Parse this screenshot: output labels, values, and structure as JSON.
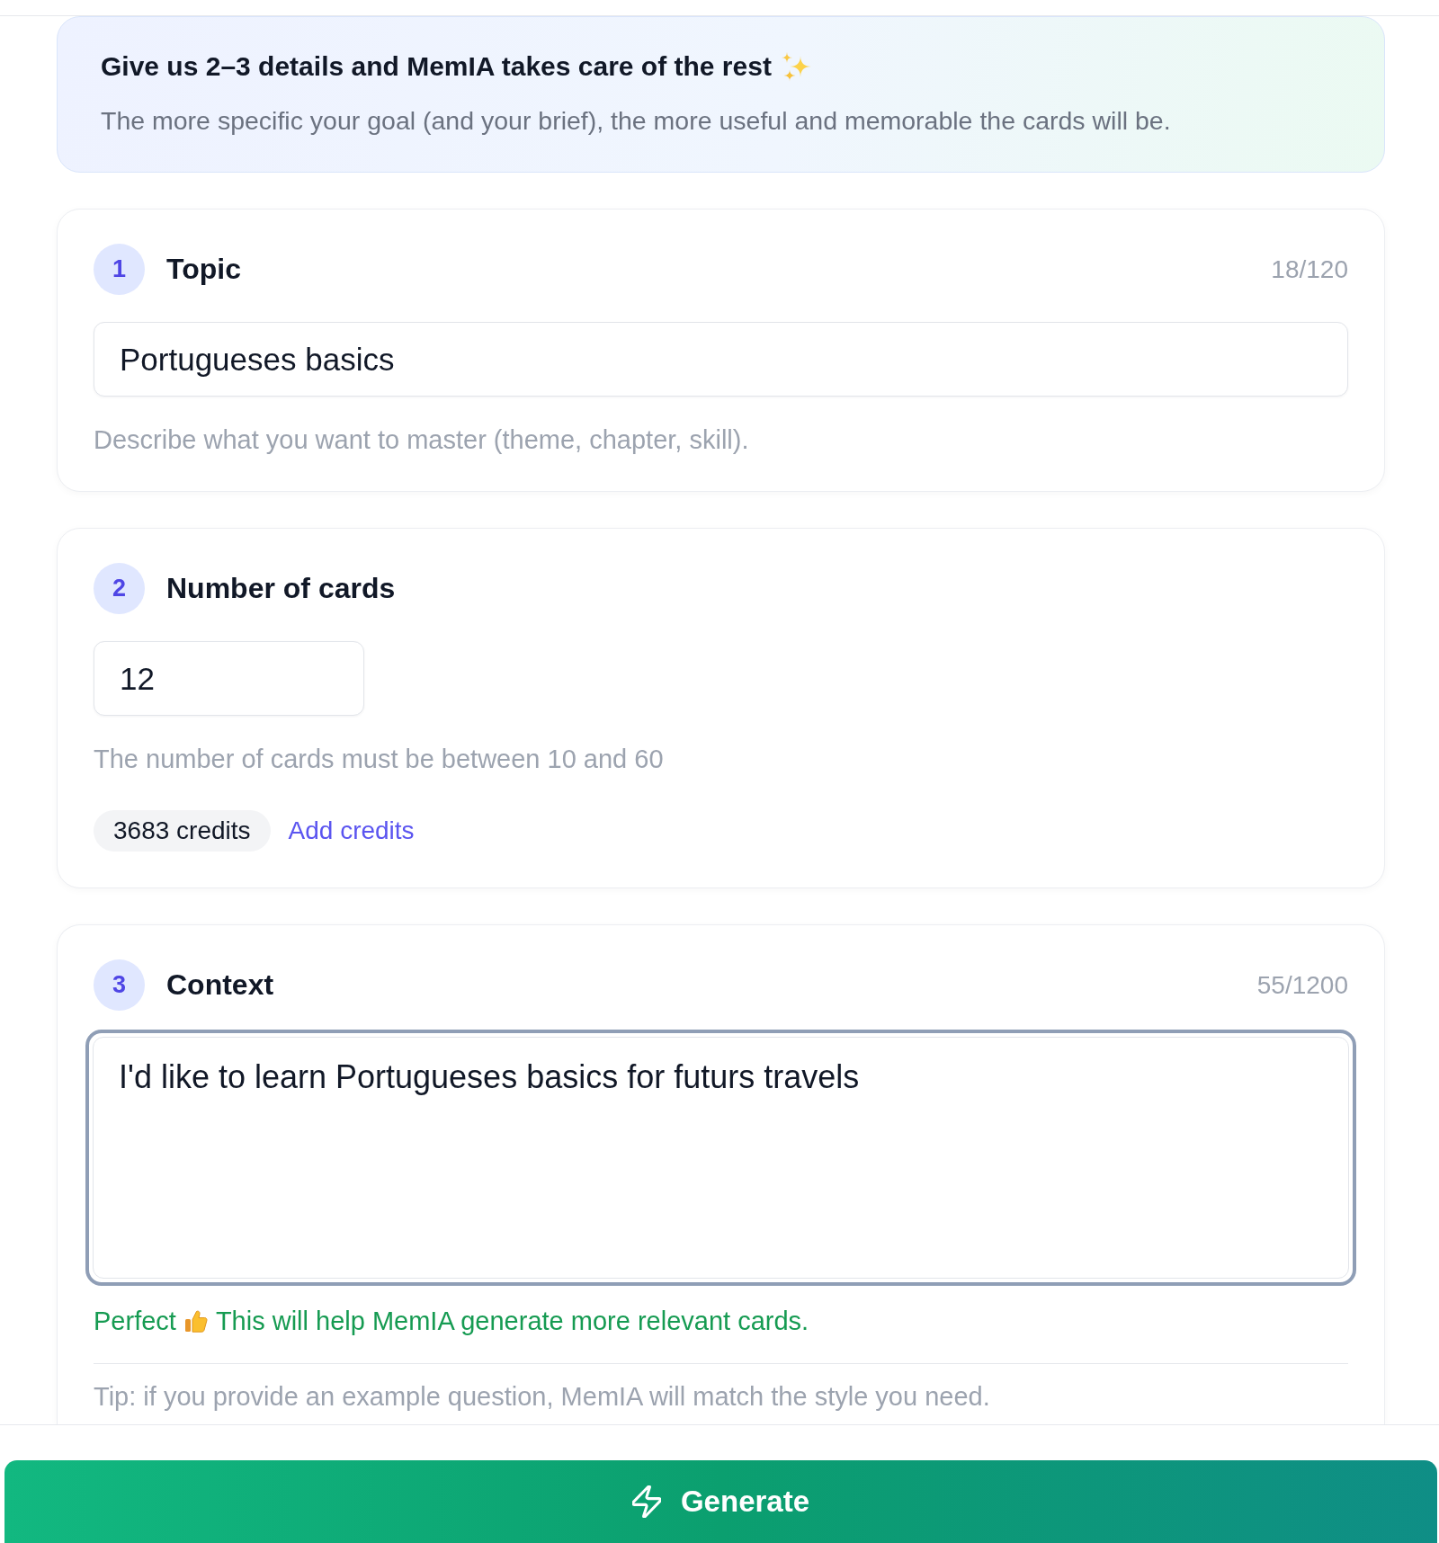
{
  "intro": {
    "title": "Give us 2–3 details and MemIA takes care of the rest",
    "subtitle": "The more specific your goal (and your brief), the more useful and memorable the cards will be."
  },
  "steps": [
    {
      "kind": "text",
      "number": "1",
      "title": "Topic",
      "counter": "18/120",
      "value": "Portugueses basics",
      "hint": "Describe what you want to master (theme, chapter, skill)."
    },
    {
      "kind": "number",
      "number": "2",
      "title": "Number of cards",
      "value": "12",
      "hint": "The number of cards must be between 10 and 60",
      "credits": {
        "balance": "3683 credits",
        "link": "Add credits"
      }
    },
    {
      "kind": "textarea",
      "number": "3",
      "title": "Context",
      "counter": "55/1200",
      "value": "I'd like to learn Portugueses basics for futurs travels",
      "focused": true,
      "feedback": {
        "lead": "Perfect",
        "message": "This will help MemIA generate more relevant cards."
      },
      "tip": "Tip: if you provide an example question, MemIA will match the style you need."
    }
  ],
  "generate_button": {
    "label": "Generate"
  }
}
